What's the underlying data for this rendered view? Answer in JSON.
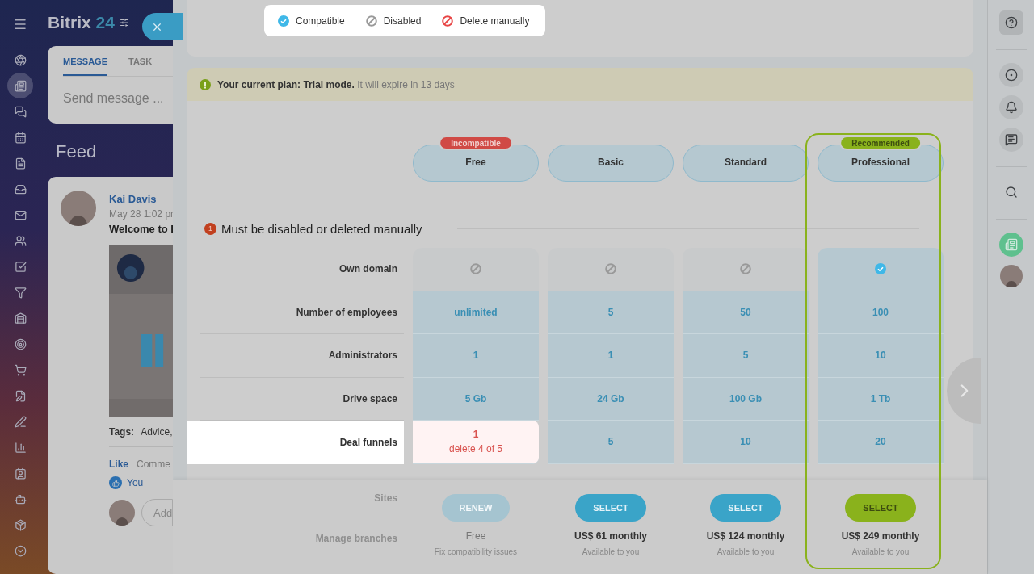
{
  "app": {
    "logo": "Bitrix",
    "logo_number": "24",
    "nav": [
      {
        "selected": false
      },
      {
        "selected": true
      },
      {
        "selected": false
      },
      {
        "selected": false
      },
      {
        "selected": false
      },
      {
        "selected": false
      },
      {
        "selected": false
      },
      {
        "selected": false
      },
      {
        "selected": false
      },
      {
        "selected": false
      },
      {
        "selected": false
      },
      {
        "selected": false
      },
      {
        "selected": false
      },
      {
        "selected": false
      },
      {
        "selected": false
      },
      {
        "selected": false
      },
      {
        "selected": false
      },
      {
        "selected": false
      },
      {
        "selected": false
      },
      {
        "selected": false
      }
    ],
    "composer_tabs": [
      {
        "label": "MESSAGE",
        "selected": true
      },
      {
        "label": "TASK",
        "selected": false
      }
    ],
    "composer_placeholder": "Send message ...",
    "feed_title": "Feed",
    "post": {
      "author": "Kai Davis",
      "date": "May 28 1:02 pr",
      "title": "Welcome to I",
      "tags_label": "Tags:",
      "tags": "Advice,",
      "like": "Like",
      "comment": "Comme",
      "reaction": "You",
      "comment_placeholder": "Add"
    }
  },
  "legend": [
    {
      "label": "Compatible",
      "kind": "compatible"
    },
    {
      "label": "Disabled",
      "kind": "disabled"
    },
    {
      "label": "Delete manually",
      "kind": "delete"
    }
  ],
  "banner": "**Your current plan: Trial mode.** It will expire in 13 days",
  "plans": [
    {
      "name": "Free",
      "badge": {
        "text": "Incompatible",
        "kind": "bad"
      },
      "recommended": false,
      "button": "RENEW",
      "disabled": true,
      "price": "Free",
      "note": "Fix compatibility issues"
    },
    {
      "name": "Basic",
      "recommended": false,
      "button": "SELECT",
      "disabled": false,
      "price": "US$ 61 monthly",
      "note": "Available to you"
    },
    {
      "name": "Standard",
      "recommended": false,
      "button": "SELECT",
      "disabled": false,
      "price": "US$ 124 monthly",
      "note": "Available to you"
    },
    {
      "name": "Professional",
      "badge": {
        "text": "Recommended",
        "kind": "good"
      },
      "recommended": true,
      "button": "SELECT",
      "disabled": false,
      "price": "US$ 249 monthly",
      "note": "Available to you"
    }
  ],
  "section": {
    "count": "1",
    "title": "Must be disabled or deleted manually"
  },
  "rows": [
    {
      "label": "Own domain",
      "highlighted": false,
      "cells": [
        {
          "kind": "disabled"
        },
        {
          "kind": "disabled"
        },
        {
          "kind": "disabled"
        },
        {
          "kind": "compatible"
        }
      ]
    },
    {
      "label": "Number of employees",
      "highlighted": false,
      "cells": [
        {
          "kind": "value",
          "value": "unlimited"
        },
        {
          "kind": "value",
          "value": "5"
        },
        {
          "kind": "value",
          "value": "50"
        },
        {
          "kind": "value",
          "value": "100"
        }
      ]
    },
    {
      "label": "Administrators",
      "highlighted": false,
      "cells": [
        {
          "kind": "value",
          "value": "1"
        },
        {
          "kind": "value",
          "value": "1"
        },
        {
          "kind": "value",
          "value": "5"
        },
        {
          "kind": "value",
          "value": "10"
        }
      ]
    },
    {
      "label": "Drive space",
      "highlighted": false,
      "cells": [
        {
          "kind": "value",
          "value": "5 Gb"
        },
        {
          "kind": "value",
          "value": "24 Gb"
        },
        {
          "kind": "value",
          "value": "100 Gb"
        },
        {
          "kind": "value",
          "value": "1 Tb"
        }
      ]
    },
    {
      "label": "Deal funnels",
      "highlighted": true,
      "cells": [
        {
          "kind": "delete",
          "value": "1",
          "note": "delete 4 of 5"
        },
        {
          "kind": "value",
          "value": "5"
        },
        {
          "kind": "value",
          "value": "10"
        },
        {
          "kind": "value",
          "value": "20"
        }
      ]
    }
  ],
  "hidden_rows": [
    "Sites",
    "Manage branches"
  ]
}
